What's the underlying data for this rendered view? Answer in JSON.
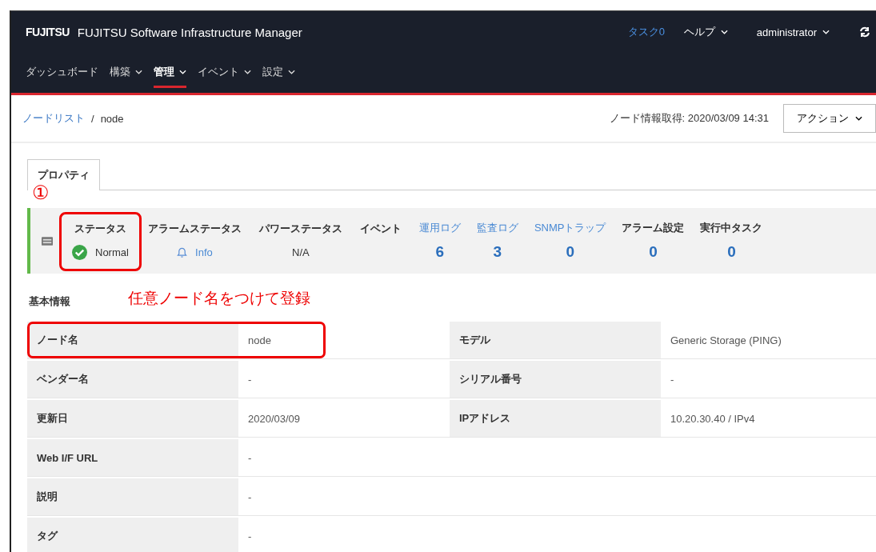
{
  "header": {
    "logo": "FUJITSU",
    "product": "FUJITSU Software Infrastructure Manager",
    "tasks": "タスク0",
    "help": "ヘルプ",
    "user": "administrator"
  },
  "nav": [
    {
      "label": "ダッシュボード",
      "menu": false,
      "selected": false
    },
    {
      "label": "構築",
      "menu": true,
      "selected": false
    },
    {
      "label": "管理",
      "menu": true,
      "selected": true
    },
    {
      "label": "イベント",
      "menu": true,
      "selected": false
    },
    {
      "label": "設定",
      "menu": true,
      "selected": false
    }
  ],
  "breadcrumb_separator": "/",
  "breadcrumb": [
    {
      "label": "ノードリスト",
      "link": true
    },
    {
      "label": "node",
      "link": false
    }
  ],
  "fetched": "ノード情報取得: 2020/03/09 14:31",
  "action_button": "アクション",
  "tabs": [
    {
      "label": "プロパティ",
      "selected": true
    }
  ],
  "annotation_number": "①",
  "status_items": [
    {
      "kind": "status",
      "label": "ステータス",
      "value": "Normal",
      "highlighted": true
    },
    {
      "kind": "alarm",
      "label": "アラームステータス",
      "value": "Info",
      "highlighted": false
    },
    {
      "kind": "power",
      "label": "パワーステータス",
      "value": "N/A",
      "highlighted": false
    },
    {
      "kind": "event",
      "label": "イベント",
      "highlighted": false
    },
    {
      "kind": "count",
      "label": "運用ログ",
      "value": "6",
      "link": true,
      "highlighted": false
    },
    {
      "kind": "count",
      "label": "監査ログ",
      "value": "3",
      "link": true,
      "highlighted": false
    },
    {
      "kind": "count",
      "label": "SNMPトラップ",
      "value": "0",
      "link": true,
      "highlighted": false
    },
    {
      "kind": "count",
      "label": "アラーム設定",
      "value": "0",
      "link": false,
      "highlighted": false
    },
    {
      "kind": "count",
      "label": "実行中タスク",
      "value": "0",
      "link": false,
      "highlighted": false
    }
  ],
  "basic_info": {
    "title": "基本情報",
    "note": "任意ノード名をつけて登録",
    "rows": [
      {
        "highlighted": true,
        "cells": [
          "ノード名",
          "node",
          "モデル",
          "Generic Storage (PING)"
        ]
      },
      {
        "highlighted": false,
        "cells": [
          "ベンダー名",
          "-",
          "シリアル番号",
          "-"
        ]
      },
      {
        "highlighted": false,
        "cells": [
          "更新日",
          "2020/03/09",
          "IPアドレス",
          "10.20.30.40 / IPv4"
        ]
      },
      {
        "highlighted": false,
        "cells": [
          "Web I/F URL",
          "-"
        ]
      },
      {
        "highlighted": false,
        "cells": [
          "説明",
          "-"
        ]
      },
      {
        "highlighted": false,
        "cells": [
          "タグ",
          "-"
        ]
      }
    ]
  }
}
